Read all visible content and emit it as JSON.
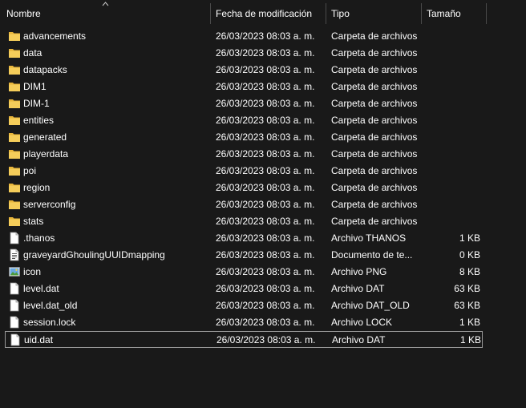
{
  "columns": {
    "name": "Nombre",
    "date": "Fecha de modificación",
    "type": "Tipo",
    "size": "Tamaño"
  },
  "rows": [
    {
      "name": "advancements",
      "date": "26/03/2023 08:03 a. m.",
      "type": "Carpeta de archivos",
      "size": "",
      "icon": "folder-icon"
    },
    {
      "name": "data",
      "date": "26/03/2023 08:03 a. m.",
      "type": "Carpeta de archivos",
      "size": "",
      "icon": "folder-icon"
    },
    {
      "name": "datapacks",
      "date": "26/03/2023 08:03 a. m.",
      "type": "Carpeta de archivos",
      "size": "",
      "icon": "folder-icon"
    },
    {
      "name": "DIM1",
      "date": "26/03/2023 08:03 a. m.",
      "type": "Carpeta de archivos",
      "size": "",
      "icon": "folder-icon"
    },
    {
      "name": "DIM-1",
      "date": "26/03/2023 08:03 a. m.",
      "type": "Carpeta de archivos",
      "size": "",
      "icon": "folder-icon"
    },
    {
      "name": "entities",
      "date": "26/03/2023 08:03 a. m.",
      "type": "Carpeta de archivos",
      "size": "",
      "icon": "folder-icon"
    },
    {
      "name": "generated",
      "date": "26/03/2023 08:03 a. m.",
      "type": "Carpeta de archivos",
      "size": "",
      "icon": "folder-icon"
    },
    {
      "name": "playerdata",
      "date": "26/03/2023 08:03 a. m.",
      "type": "Carpeta de archivos",
      "size": "",
      "icon": "folder-icon"
    },
    {
      "name": "poi",
      "date": "26/03/2023 08:03 a. m.",
      "type": "Carpeta de archivos",
      "size": "",
      "icon": "folder-icon"
    },
    {
      "name": "region",
      "date": "26/03/2023 08:03 a. m.",
      "type": "Carpeta de archivos",
      "size": "",
      "icon": "folder-icon"
    },
    {
      "name": "serverconfig",
      "date": "26/03/2023 08:03 a. m.",
      "type": "Carpeta de archivos",
      "size": "",
      "icon": "folder-icon"
    },
    {
      "name": "stats",
      "date": "26/03/2023 08:03 a. m.",
      "type": "Carpeta de archivos",
      "size": "",
      "icon": "folder-icon"
    },
    {
      "name": ".thanos",
      "date": "26/03/2023 08:03 a. m.",
      "type": "Archivo THANOS",
      "size": "1 KB",
      "icon": "file-icon"
    },
    {
      "name": "graveyardGhoulingUUIDmapping",
      "date": "26/03/2023 08:03 a. m.",
      "type": "Documento de te...",
      "size": "0 KB",
      "icon": "text-document-icon"
    },
    {
      "name": "icon",
      "date": "26/03/2023 08:03 a. m.",
      "type": "Archivo PNG",
      "size": "8 KB",
      "icon": "image-file-icon"
    },
    {
      "name": "level.dat",
      "date": "26/03/2023 08:03 a. m.",
      "type": "Archivo DAT",
      "size": "63 KB",
      "icon": "file-icon"
    },
    {
      "name": "level.dat_old",
      "date": "26/03/2023 08:03 a. m.",
      "type": "Archivo DAT_OLD",
      "size": "63 KB",
      "icon": "file-icon"
    },
    {
      "name": "session.lock",
      "date": "26/03/2023 08:03 a. m.",
      "type": "Archivo LOCK",
      "size": "1 KB",
      "icon": "file-icon"
    },
    {
      "name": "uid.dat",
      "date": "26/03/2023 08:03 a. m.",
      "type": "Archivo DAT",
      "size": "1 KB",
      "icon": "file-icon"
    }
  ],
  "selected_row": "uid.dat",
  "colors": {
    "background": "#191919",
    "text": "#ffffff",
    "folder": "#f0c050",
    "selection_border": "#999999"
  }
}
